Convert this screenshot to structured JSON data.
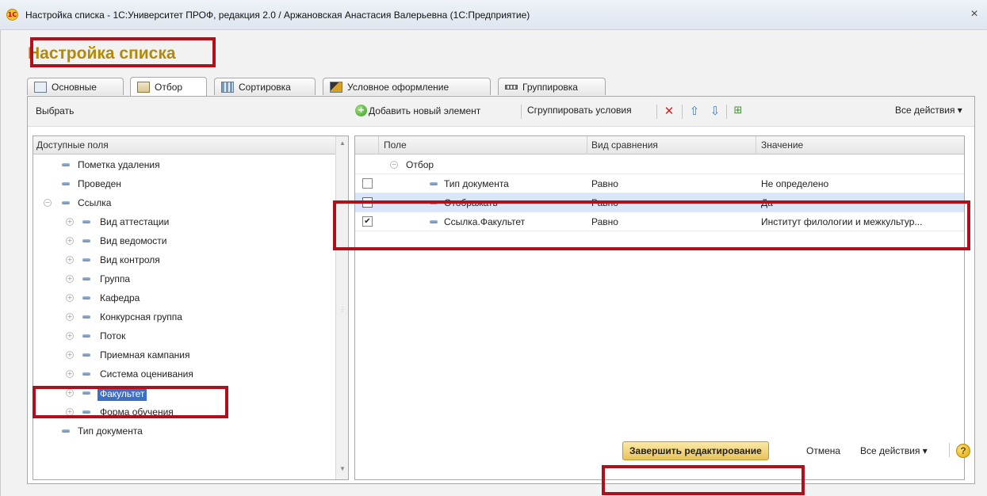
{
  "window": {
    "title": "Настройка списка - 1С:Университет ПРОФ, редакция 2.0 / Аржановская Анастасия Валерьевна  (1С:Предприятие)",
    "app_icon_text": "1С",
    "close_glyph": "×"
  },
  "page": {
    "heading": "Настройка списка"
  },
  "tabs": [
    {
      "label": "Основные",
      "icon": "document-icon"
    },
    {
      "label": "Отбор",
      "icon": "filter-icon",
      "active": true
    },
    {
      "label": "Сортировка",
      "icon": "sort-icon"
    },
    {
      "label": "Условное оформление",
      "icon": "conditional-format-icon"
    },
    {
      "label": "Группировка",
      "icon": "grouping-icon"
    }
  ],
  "toolbar": {
    "select_label": "Выбрать",
    "add_label": "Добавить новый элемент",
    "group_label": "Сгруппировать условия",
    "all_actions": "Все действия ▾"
  },
  "fields_tree": {
    "header": "Доступные поля",
    "items": [
      {
        "label": "Пометка удаления",
        "level": 0,
        "expandable": false
      },
      {
        "label": "Проведен",
        "level": 0,
        "expandable": false
      },
      {
        "label": "Ссылка",
        "level": 0,
        "expandable": true,
        "expanded": true
      },
      {
        "label": "Вид аттестации",
        "level": 1,
        "expandable": true
      },
      {
        "label": "Вид ведомости",
        "level": 1,
        "expandable": true
      },
      {
        "label": "Вид контроля",
        "level": 1,
        "expandable": true
      },
      {
        "label": "Группа",
        "level": 1,
        "expandable": true
      },
      {
        "label": "Кафедра",
        "level": 1,
        "expandable": true
      },
      {
        "label": "Конкурсная группа",
        "level": 1,
        "expandable": true
      },
      {
        "label": "Поток",
        "level": 1,
        "expandable": true
      },
      {
        "label": "Приемная кампания",
        "level": 1,
        "expandable": true
      },
      {
        "label": "Система оценивания",
        "level": 1,
        "expandable": true
      },
      {
        "label": "Факультет",
        "level": 1,
        "expandable": true,
        "selected": true
      },
      {
        "label": "Форма обучения",
        "level": 1,
        "expandable": true
      },
      {
        "label": "Тип документа",
        "level": 0,
        "expandable": false
      }
    ]
  },
  "filter_grid": {
    "columns": [
      "Поле",
      "Вид сравнения",
      "Значение"
    ],
    "group_label": "Отбор",
    "rows": [
      {
        "checked": false,
        "field": "Тип документа",
        "comparison": "Равно",
        "value": "Не определено"
      },
      {
        "checked": false,
        "field": "Отображать",
        "comparison": "Равно",
        "value": "Да",
        "selected": true
      },
      {
        "checked": true,
        "field": "Ссылка.Факультет",
        "comparison": "Равно",
        "value": "Институт филологии и межкультур..."
      }
    ]
  },
  "footer": {
    "finish_label": "Завершить редактирование",
    "cancel_label": "Отмена",
    "all_actions": "Все действия ▾",
    "help_glyph": "?"
  },
  "colors": {
    "heading": "#b58a00",
    "highlight_box": "#b0101c",
    "selection": "#3b6ec6",
    "row_selection": "#d9e6f7"
  }
}
